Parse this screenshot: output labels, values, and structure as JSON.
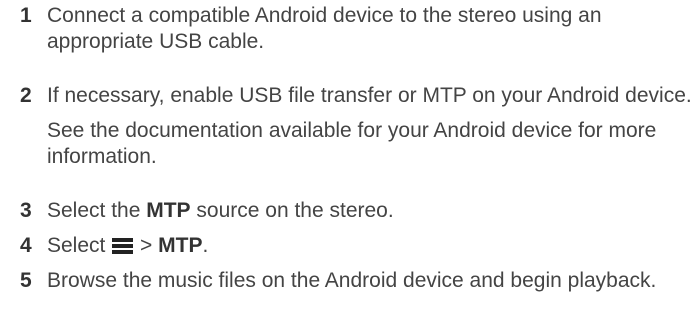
{
  "steps": [
    {
      "number": "1",
      "text": "Connect a compatible Android device to the stereo using an appropriate USB cable."
    },
    {
      "number": "2",
      "text": "If necessary, enable USB file transfer or MTP on your Android device.",
      "note": "See the documentation available for your Android device for more information."
    },
    {
      "number": "3",
      "before": "Select the ",
      "bold": "MTP",
      "after": " source on the stereo."
    },
    {
      "number": "4",
      "before": "Select ",
      "icon": "menu-icon",
      "between": " > ",
      "bold": "MTP",
      "after": "."
    },
    {
      "number": "5",
      "text": "Browse the music files on the Android device and begin playback."
    }
  ]
}
